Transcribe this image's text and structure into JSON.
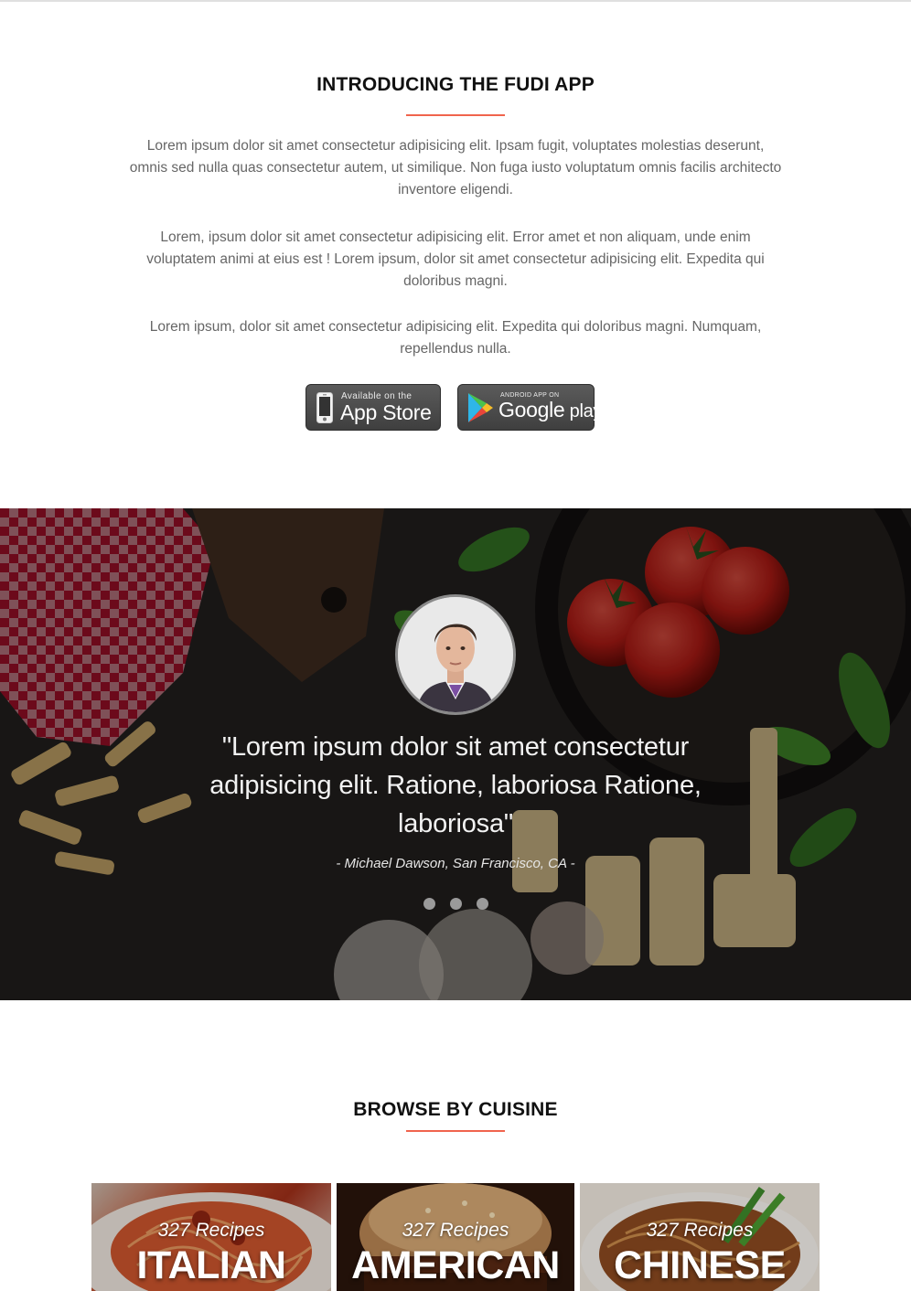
{
  "intro": {
    "title": "INTRODUCING THE FUDI APP",
    "paragraphs": [
      "Lorem ipsum dolor sit amet consectetur adipisicing elit. Ipsam fugit, voluptates molestias deserunt, omnis sed nulla quas consectetur autem, ut similique. Non fuga iusto voluptatum omnis facilis architecto inventore eligendi.",
      "Lorem, ipsum dolor sit amet consectetur adipisicing elit. Error amet et non aliquam, unde enim voluptatem animi at eius est ! Lorem ipsum, dolor sit amet consectetur adipisicing elit. Expedita qui doloribus magni.",
      "Lorem ipsum, dolor sit amet consectetur adipisicing elit. Expedita qui doloribus magni. Numquam, repellendus nulla."
    ],
    "app_store": {
      "small": "Available on the",
      "big": "App Store",
      "icon": "iphone-icon"
    },
    "google_play": {
      "small": "ANDROID APP ON",
      "big": "Google",
      "big2": " play",
      "icon": "google-play-icon"
    }
  },
  "testimonial": {
    "quote": "\"Lorem ipsum dolor sit amet consectetur adipisicing elit. Ratione, laboriosa Ratione, laboriosa\"",
    "author": "- Michael Dawson, San Francisco, CA -",
    "dots": 3,
    "active_dot": 0
  },
  "browse": {
    "title": "BROWSE BY CUISINE",
    "cards": [
      {
        "count": "327 Recipes",
        "name": "ITALIAN"
      },
      {
        "count": "327 Recipes",
        "name": "AMERICAN"
      },
      {
        "count": "327 Recipes",
        "name": "CHINESE"
      }
    ]
  },
  "colors": {
    "accent": "#f0644d",
    "heading": "#111111",
    "body_text": "#666666"
  }
}
